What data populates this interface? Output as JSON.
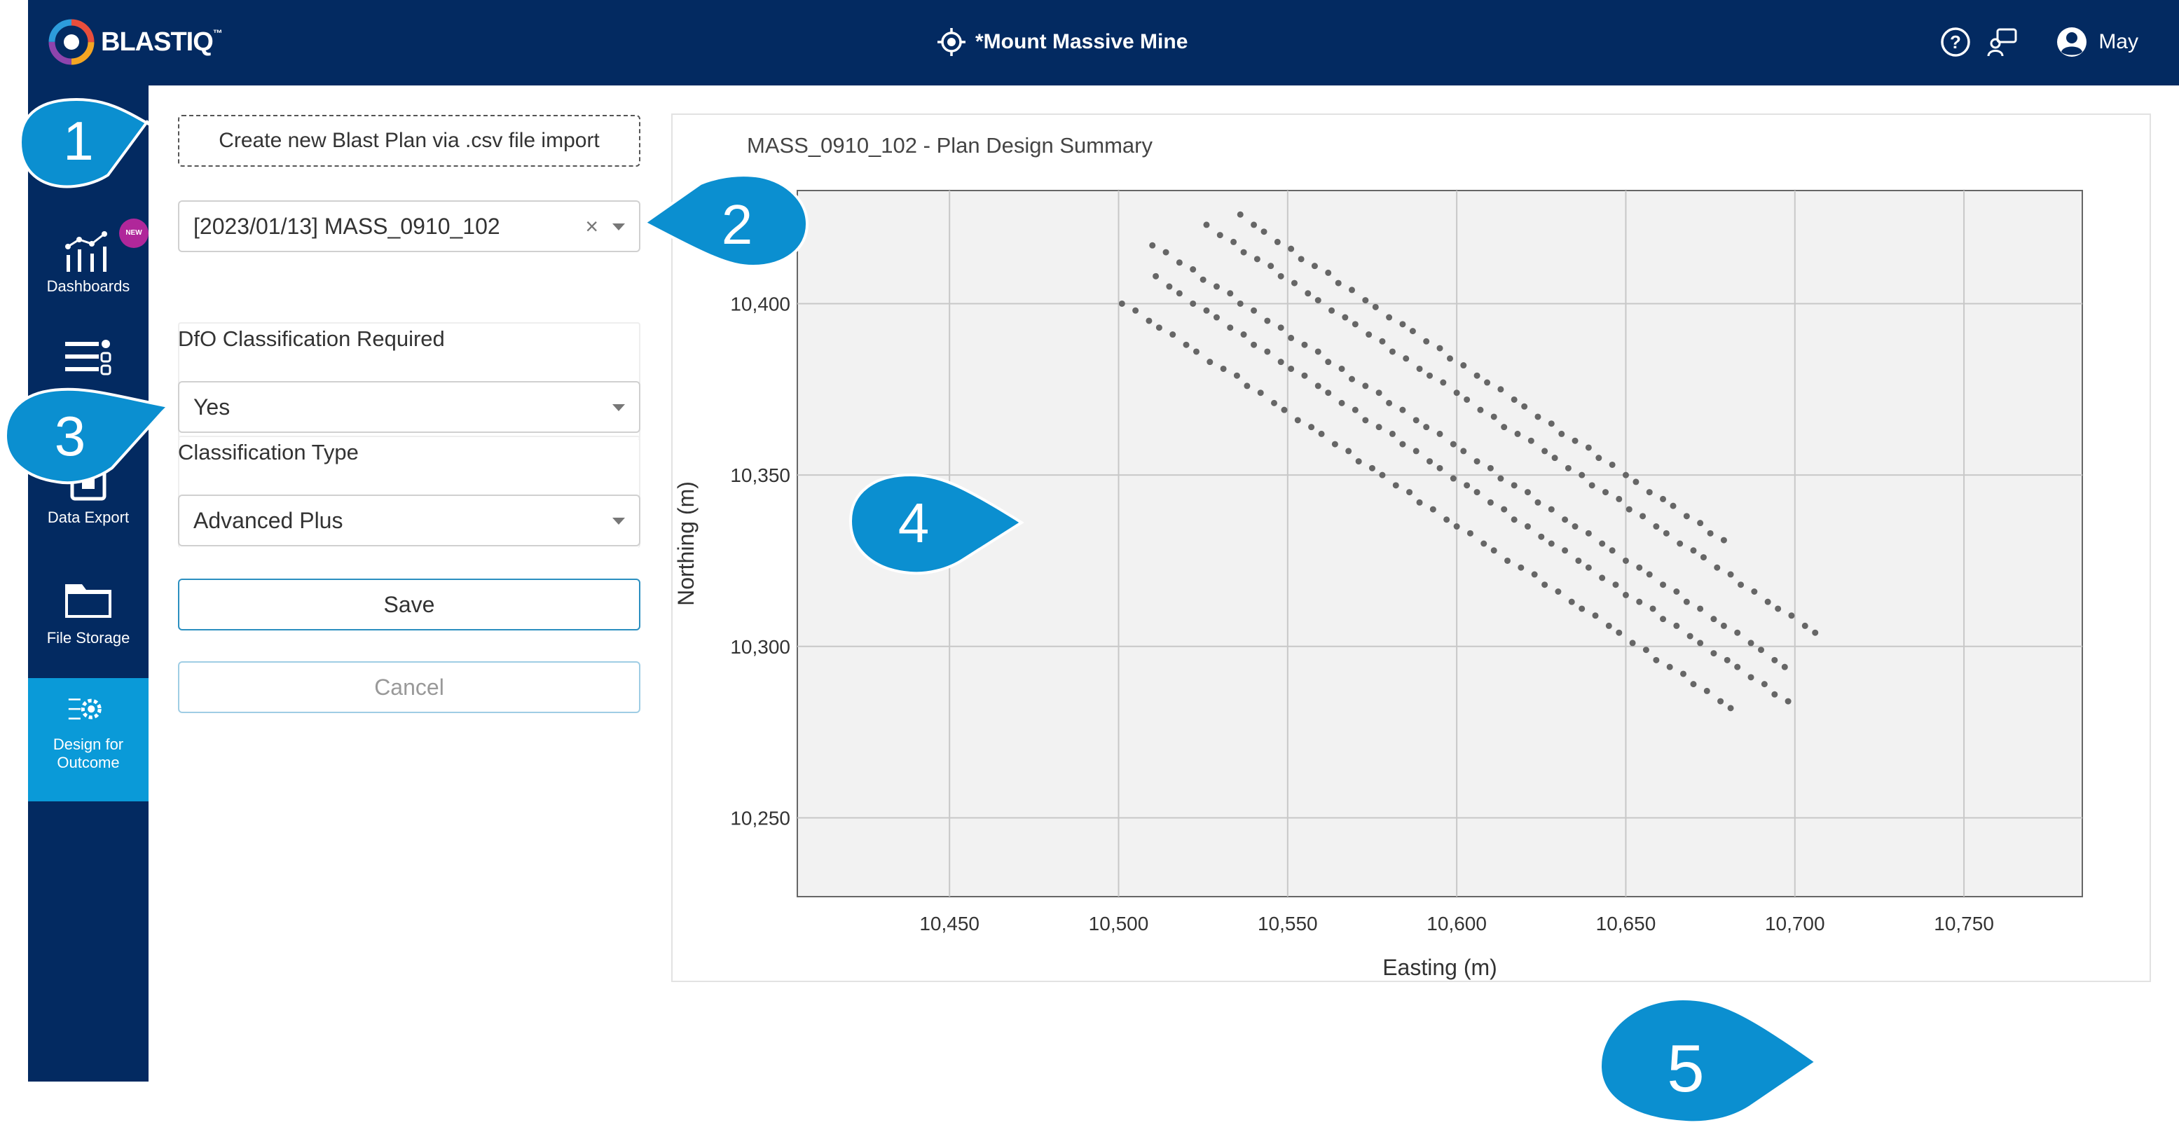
{
  "header": {
    "brand": "BLASTIQ",
    "brand_mark": "™",
    "site_name": "*Mount Massive Mine",
    "user_name": "May",
    "icons": [
      "help-icon",
      "support-chat-icon",
      "user-avatar-icon",
      "location-target-icon"
    ]
  },
  "sidebar": {
    "items": [
      {
        "label": "Dashboards",
        "icon": "dashboard-chart-icon",
        "badge": "NEW"
      },
      {
        "label": "",
        "icon": "list-settings-icon"
      },
      {
        "label": "Data Export",
        "icon": "data-export-icon"
      },
      {
        "label": "File Storage",
        "icon": "folder-icon"
      },
      {
        "label": "Design for Outcome",
        "icon": "design-gear-icon",
        "active": true
      }
    ]
  },
  "form": {
    "import_label": "Create new Blast Plan via .csv file import",
    "plan_select_value": "[2023/01/13] MASS_0910_102",
    "dfo_label": "DfO Classification Required",
    "dfo_value": "Yes",
    "classification_label": "Classification Type",
    "classification_value": "Advanced Plus",
    "save_label": "Save",
    "cancel_label": "Cancel"
  },
  "callouts": [
    "1",
    "2",
    "3",
    "4",
    "5"
  ],
  "colors": {
    "header": "#032a61",
    "active_nav": "#0a9ad8",
    "callout": "#0b8fd0",
    "badge": "#b0279a"
  },
  "chart_data": {
    "type": "scatter",
    "title": "MASS_0910_102 - Plan Design Summary",
    "xlabel": "Easting (m)",
    "ylabel": "Northing (m)",
    "xlim": [
      10405,
      10785
    ],
    "ylim": [
      10227,
      10433
    ],
    "xticks": [
      10450,
      10500,
      10550,
      10600,
      10650,
      10700,
      10750
    ],
    "yticks": [
      10250,
      10300,
      10350,
      10400
    ],
    "xtick_labels": [
      "10,450",
      "10,500",
      "10,550",
      "10,600",
      "10,650",
      "10,700",
      "10,750"
    ],
    "ytick_labels": [
      "10,250",
      "10,300",
      "10,350",
      "10,400"
    ],
    "grid": true,
    "point_color": "#666666",
    "x": [
      10510,
      10514,
      10518,
      10522,
      10525,
      10529,
      10533,
      10536,
      10540,
      10544,
      10548,
      10551,
      10555,
      10559,
      10562,
      10566,
      10569,
      10573,
      10577,
      10580,
      10584,
      10588,
      10591,
      10595,
      10599,
      10602,
      10606,
      10610,
      10613,
      10617,
      10621,
      10624,
      10628,
      10632,
      10635,
      10639,
      10643,
      10646,
      10650,
      10654,
      10657,
      10661,
      10665,
      10668,
      10672,
      10676,
      10679,
      10683,
      10687,
      10690,
      10694,
      10697,
      10501,
      10505,
      10509,
      10512,
      10516,
      10520,
      10523,
      10527,
      10531,
      10535,
      10538,
      10542,
      10546,
      10549,
      10553,
      10557,
      10560,
      10564,
      10568,
      10571,
      10575,
      10578,
      10582,
      10586,
      10589,
      10593,
      10597,
      10600,
      10604,
      10608,
      10611,
      10615,
      10619,
      10623,
      10626,
      10630,
      10634,
      10637,
      10641,
      10645,
      10648,
      10652,
      10656,
      10659,
      10663,
      10667,
      10670,
      10674,
      10678,
      10681,
      10526,
      10530,
      10534,
      10537,
      10541,
      10545,
      10548,
      10552,
      10556,
      10559,
      10563,
      10567,
      10570,
      10574,
      10578,
      10581,
      10585,
      10589,
      10592,
      10596,
      10600,
      10603,
      10607,
      10611,
      10614,
      10618,
      10622,
      10626,
      10629,
      10633,
      10637,
      10640,
      10644,
      10648,
      10651,
      10655,
      10659,
      10662,
      10666,
      10670,
      10673,
      10677,
      10681,
      10684,
      10688,
      10692,
      10695,
      10699,
      10703,
      10706,
      10511,
      10515,
      10518,
      10522,
      10526,
      10529,
      10533,
      10537,
      10540,
      10544,
      10548,
      10551,
      10555,
      10559,
      10562,
      10566,
      10570,
      10573,
      10577,
      10581,
      10584,
      10588,
      10592,
      10595,
      10599,
      10603,
      10606,
      10610,
      10614,
      10617,
      10621,
      10625,
      10628,
      10632,
      10636,
      10639,
      10643,
      10647,
      10650,
      10654,
      10658,
      10661,
      10665,
      10669,
      10672,
      10676,
      10680,
      10683,
      10687,
      10691,
      10694,
      10698,
      10536,
      10540,
      10543,
      10547,
      10551,
      10554,
      10558,
      10562,
      10565,
      10569,
      10573,
      10576,
      10580,
      10584,
      10587,
      10591,
      10595,
      10598,
      10602,
      10606,
      10609,
      10613,
      10617,
      10620,
      10624,
      10628,
      10631,
      10635,
      10639,
      10642,
      10646,
      10650,
      10653,
      10657,
      10661,
      10664,
      10668,
      10672,
      10675,
      10679
    ],
    "y": [
      10417,
      10415,
      10412,
      10410,
      10407,
      10405,
      10403,
      10400,
      10398,
      10395,
      10393,
      10390,
      10388,
      10386,
      10383,
      10381,
      10378,
      10376,
      10374,
      10371,
      10369,
      10366,
      10364,
      10362,
      10359,
      10357,
      10354,
      10352,
      10349,
      10347,
      10345,
      10342,
      10340,
      10337,
      10335,
      10333,
      10330,
      10328,
      10325,
      10323,
      10321,
      10318,
      10316,
      10313,
      10311,
      10308,
      10306,
      10304,
      10301,
      10299,
      10296,
      10294,
      10400,
      10398,
      10395,
      10393,
      10391,
      10388,
      10386,
      10383,
      10381,
      10379,
      10376,
      10374,
      10371,
      10369,
      10366,
      10364,
      10362,
      10359,
      10357,
      10354,
      10352,
      10350,
      10347,
      10345,
      10342,
      10340,
      10337,
      10335,
      10333,
      10330,
      10328,
      10325,
      10323,
      10321,
      10318,
      10316,
      10313,
      10311,
      10309,
      10306,
      10304,
      10301,
      10299,
      10296,
      10294,
      10292,
      10289,
      10287,
      10284,
      10282,
      10423,
      10420,
      10418,
      10415,
      10413,
      10411,
      10408,
      10406,
      10403,
      10401,
      10398,
      10396,
      10394,
      10391,
      10389,
      10386,
      10384,
      10381,
      10379,
      10377,
      10374,
      10372,
      10369,
      10367,
      10364,
      10362,
      10360,
      10357,
      10355,
      10352,
      10350,
      10347,
      10345,
      10343,
      10340,
      10338,
      10335,
      10333,
      10330,
      10328,
      10326,
      10323,
      10321,
      10318,
      10316,
      10313,
      10311,
      10309,
      10306,
      10304,
      10408,
      10405,
      10403,
      10400,
      10398,
      10396,
      10393,
      10391,
      10388,
      10386,
      10383,
      10381,
      10379,
      10376,
      10374,
      10371,
      10369,
      10366,
      10364,
      10362,
      10359,
      10357,
      10354,
      10352,
      10349,
      10347,
      10345,
      10342,
      10340,
      10337,
      10335,
      10332,
      10330,
      10328,
      10325,
      10323,
      10320,
      10318,
      10315,
      10313,
      10311,
      10308,
      10306,
      10303,
      10301,
      10298,
      10296,
      10294,
      10291,
      10289,
      10286,
      10284,
      10426,
      10423,
      10421,
      10418,
      10416,
      10413,
      10411,
      10409,
      10406,
      10404,
      10401,
      10399,
      10396,
      10394,
      10392,
      10389,
      10387,
      10384,
      10382,
      10379,
      10377,
      10375,
      10372,
      10370,
      10367,
      10365,
      10362,
      10360,
      10358,
      10355,
      10353,
      10350,
      10348,
      10345,
      10343,
      10341,
      10338,
      10336,
      10333,
      10331
    ]
  }
}
